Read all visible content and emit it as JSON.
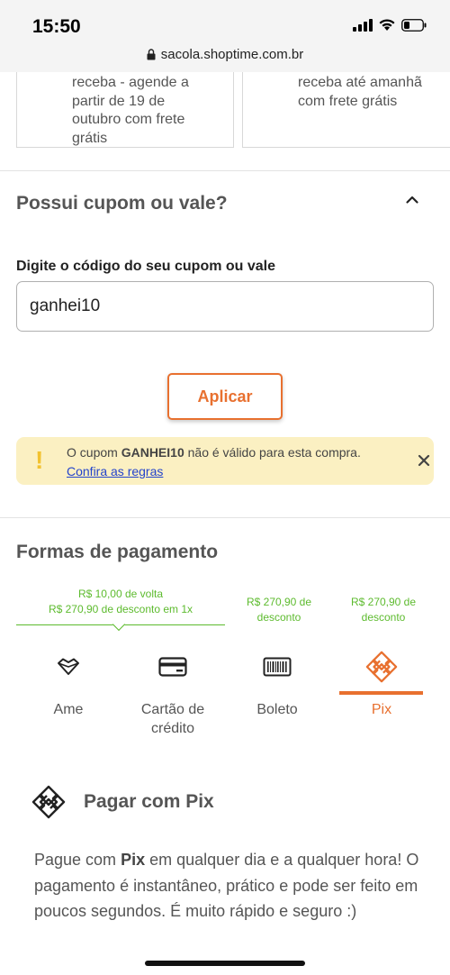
{
  "status_bar": {
    "time": "15:50"
  },
  "browser": {
    "url": "sacola.shoptime.com.br"
  },
  "delivery": {
    "left_lines": [
      "receba - agende a",
      "partir de 19 de",
      "outubro com frete",
      "grátis"
    ],
    "right_lines": [
      "receba até amanhã",
      "com frete grátis"
    ]
  },
  "coupon": {
    "title": "Possui cupom ou vale?",
    "input_label": "Digite o código do seu cupom ou vale",
    "input_value": "ganhei10",
    "apply_label": "Aplicar"
  },
  "alert": {
    "prefix": "O cupom",
    "code": "GANHEI10",
    "suffix": "não é válido para esta compra.",
    "link": "Confira as regras"
  },
  "payment": {
    "title": "Formas de pagamento",
    "ame_promo_line1": "R$ 10,00 de volta",
    "ame_promo_line2": "R$ 270,90 de desconto em 1x",
    "boleto_promo_line1": "R$ 270,90 de",
    "boleto_promo_line2": "desconto",
    "pix_promo_line1": "R$ 270,90 de",
    "pix_promo_line2": "desconto",
    "tabs": [
      {
        "line1": "Ame",
        "line2": "",
        "icon": "ame-heart-icon"
      },
      {
        "line1": "Cartão de",
        "line2": "crédito",
        "icon": "credit-card-icon"
      },
      {
        "line1": "Boleto",
        "line2": "",
        "icon": "barcode-icon"
      },
      {
        "line1": "Pix",
        "line2": "",
        "icon": "pix-icon"
      }
    ],
    "active_tab": "Pix",
    "accent_color": "#e8702f",
    "promo_color": "#5dbb2e"
  },
  "pix": {
    "title": "Pagar com Pix",
    "desc_part1": "Pague com",
    "desc_bold": "Pix",
    "desc_part2": "em qualquer dia e a qualquer hora! O pagamento é instantâneo, prático e pode ser feito em poucos segundos. É muito rápido e seguro :)"
  }
}
